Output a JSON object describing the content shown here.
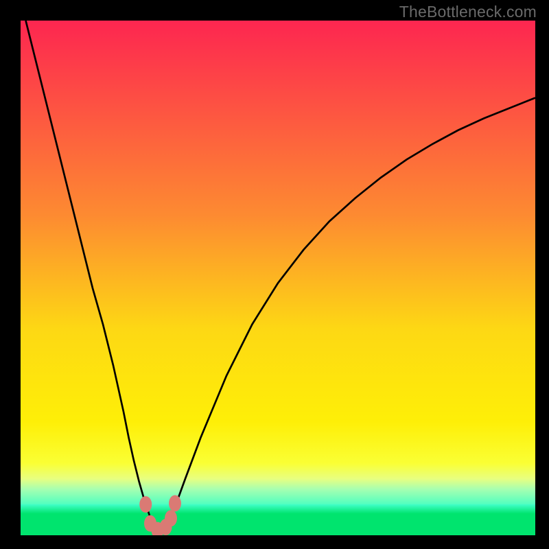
{
  "watermark": "TheBottleneck.com",
  "colors": {
    "black_frame": "#000000",
    "gradient_top": "#fd2650",
    "gradient_38": "#fd8b31",
    "gradient_60": "#fdd814",
    "gradient_78": "#feef07",
    "gradient_86": "#faff34",
    "gradient_89": "#e8ff80",
    "gradient_91": "#a8ffb0",
    "gradient_bottom_before_band": "#50ffc0",
    "green_band": "#00e46e",
    "curve_stroke": "#000000",
    "marker_fill": "#da7a74",
    "watermark_color": "#6a6a6a"
  },
  "chart_data": {
    "type": "line",
    "title": "",
    "xlabel": "",
    "ylabel": "",
    "xlim": [
      0,
      100
    ],
    "ylim": [
      0,
      100
    ],
    "x": [
      1,
      4,
      6,
      8,
      10,
      12,
      14,
      16,
      18,
      20,
      21,
      22,
      23,
      24,
      25,
      25.5,
      26,
      26.7,
      27.4,
      28,
      29,
      30,
      32,
      35,
      40,
      45,
      50,
      55,
      60,
      65,
      70,
      75,
      80,
      85,
      90,
      95,
      100
    ],
    "values": [
      100,
      88,
      80,
      72,
      64,
      56,
      48,
      41,
      33,
      24,
      19,
      14.5,
      10.5,
      7,
      4,
      2.5,
      1.5,
      1.0,
      1.0,
      1.5,
      3.0,
      5.5,
      11,
      19,
      31,
      41,
      49,
      55.5,
      61,
      65.5,
      69.5,
      73,
      76,
      78.7,
      81,
      83,
      85
    ],
    "minimum_x": 27,
    "markers": [
      {
        "x": 24.3,
        "y": 6.0
      },
      {
        "x": 25.2,
        "y": 2.3
      },
      {
        "x": 26.6,
        "y": 1.0
      },
      {
        "x": 28.2,
        "y": 1.6
      },
      {
        "x": 29.2,
        "y": 3.3
      },
      {
        "x": 30.0,
        "y": 6.2
      }
    ],
    "notes": "Curve depicts bottleneck percentage; values read off vertical gradient position. Minimum ≈ x=27, value≈1. Markers are salmon dots near the trough."
  }
}
